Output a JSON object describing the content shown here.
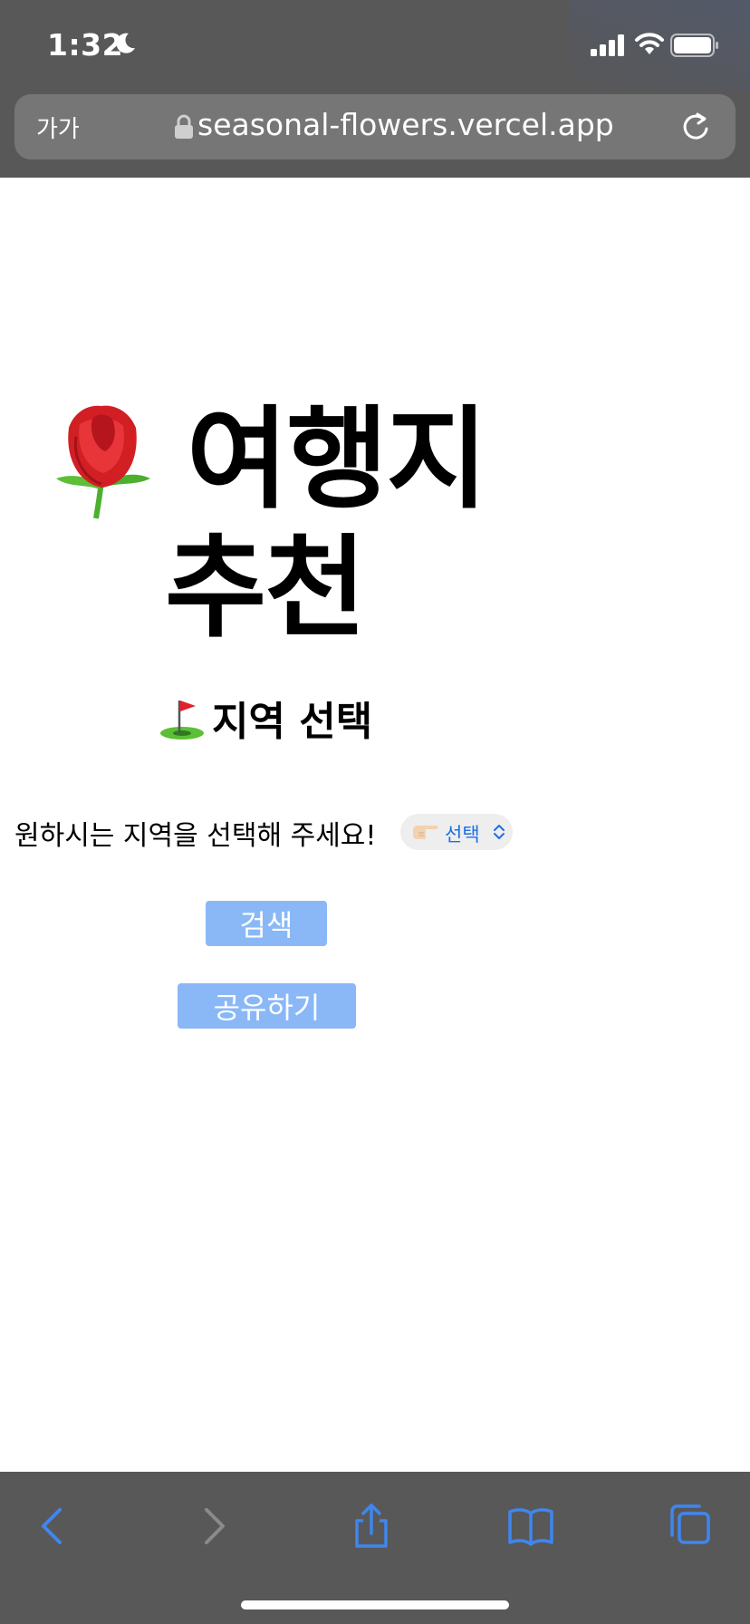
{
  "status_bar": {
    "time": "1:32"
  },
  "browser": {
    "text_size_label": "가가",
    "url": "seasonal-flowers.vercel.app"
  },
  "page": {
    "title_line1": "여행지",
    "title_line2": "추천",
    "section_heading": "지역 선택",
    "prompt": "원하시는 지역을 선택해 주세요!",
    "region_select": {
      "selected": "선택"
    },
    "search_button": "검색",
    "share_button": "공유하기"
  },
  "colors": {
    "chrome_background": "#585858",
    "url_bar": "#767676",
    "button_fill": "#8ab8f7",
    "select_text": "#1e6fe0",
    "toolbar_icon": "#3f86f0",
    "toolbar_icon_disabled": "#8a8a8a"
  },
  "icons": [
    "moon-icon",
    "signal-icon",
    "wifi-icon",
    "battery-icon",
    "lock-icon",
    "reload-icon",
    "rose-icon",
    "golf-flag-icon",
    "pointing-hand-icon",
    "chevrons-icon",
    "back-icon",
    "forward-icon",
    "share-icon",
    "bookmarks-icon",
    "tabs-icon"
  ]
}
